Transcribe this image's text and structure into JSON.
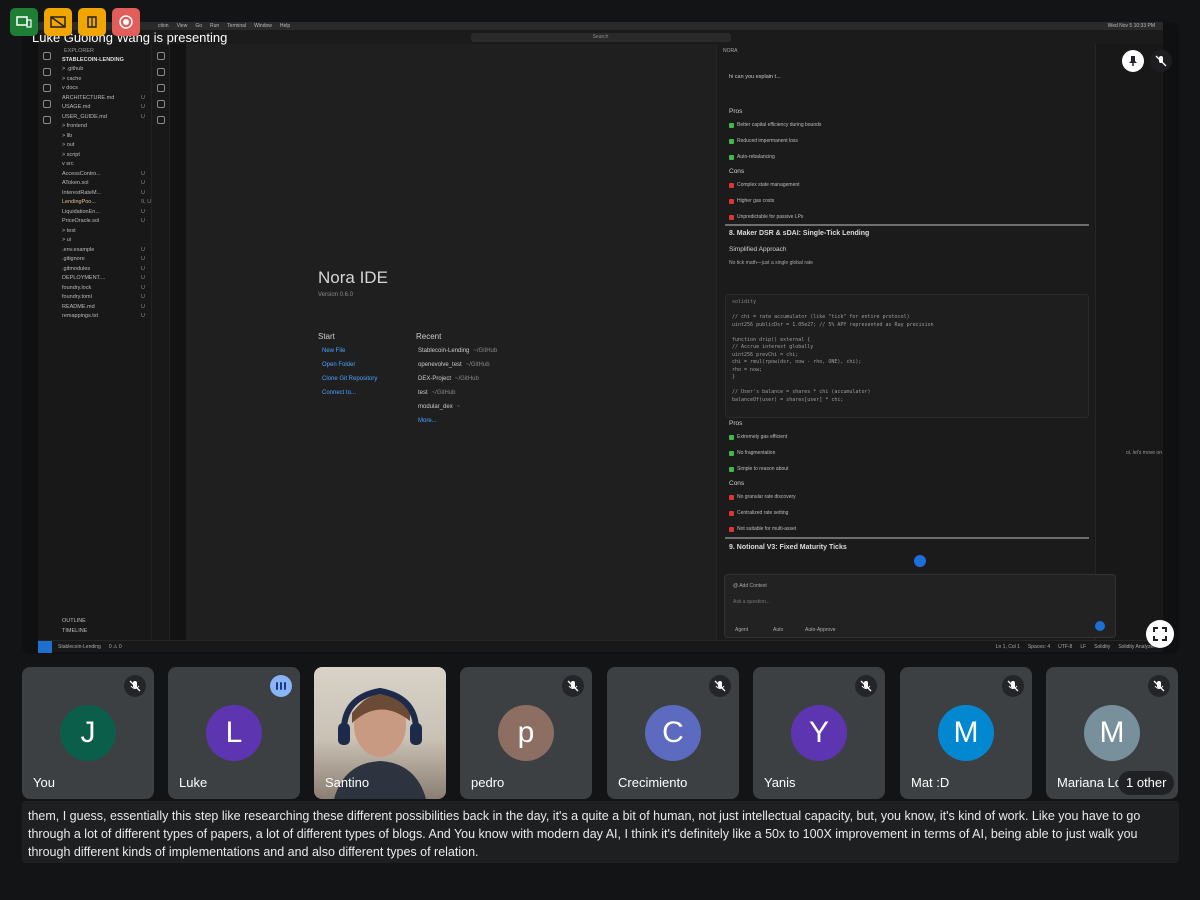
{
  "meet": {
    "presenting_text": "Luke Guolong Wang is presenting",
    "caption_text": "them, I guess, essentially this step like researching these different possibilities back in the day, it's a quite a bit of human, not just intellectual capacity, but, you know, it's kind of work. Like you have to go through a lot of different types of papers, a lot of different types of blogs. And You know with modern day AI, I think it's definitely like a 50x to 100X improvement in terms of AI, being able to just walk you through different kinds of implementations and and also different types of relation.",
    "other_count_label": "1 other",
    "colors": {
      "background": "#131416",
      "tile": "#3c4043",
      "speaking": "#8ab4f8"
    }
  },
  "participants": [
    {
      "name": "You",
      "initial": "J",
      "color": "#0b5e4a",
      "status": "muted"
    },
    {
      "name": "Luke",
      "initial": "L",
      "color": "#5e35b1",
      "status": "speaking"
    },
    {
      "name": "Santino",
      "initial": "",
      "color": "",
      "status": "video"
    },
    {
      "name": "pedro",
      "initial": "p",
      "color": "#8d6e63",
      "status": "muted"
    },
    {
      "name": "Crecimiento",
      "initial": "C",
      "color": "#5c6bc0",
      "status": "muted"
    },
    {
      "name": "Yanis",
      "initial": "Y",
      "color": "#5e35b1",
      "status": "muted"
    },
    {
      "name": "Mat :D",
      "initial": "M",
      "color": "#0288d1",
      "status": "muted"
    },
    {
      "name": "Mariana Lo",
      "initial": "M",
      "color": "#78909c",
      "status": "muted"
    }
  ],
  "ide": {
    "menu": [
      "ction",
      "View",
      "Go",
      "Run",
      "Terminal",
      "Window",
      "Help"
    ],
    "search_placeholder": "Search",
    "clock": "Wed Nov 5  10:33 PM",
    "explorer_header": "EXPLORER",
    "project_name": "STABLECOIN-LENDING",
    "tree": [
      {
        "name": "> .github",
        "status": ""
      },
      {
        "name": "> cache",
        "status": ""
      },
      {
        "name": "v docs",
        "status": ""
      },
      {
        "name": "   ARCHITECTURE.md",
        "status": "U"
      },
      {
        "name": "   USAGE.md",
        "status": "U"
      },
      {
        "name": "   USER_GUIDE.md",
        "status": "U"
      },
      {
        "name": "> frontend",
        "status": ""
      },
      {
        "name": "> lib",
        "status": ""
      },
      {
        "name": "> out",
        "status": ""
      },
      {
        "name": "> script",
        "status": ""
      },
      {
        "name": "v src",
        "status": ""
      },
      {
        "name": "   AccessContro...",
        "status": "U"
      },
      {
        "name": "   AToken.sol",
        "status": "U"
      },
      {
        "name": "   InterestRateM...",
        "status": "U"
      },
      {
        "name": "   LendingPoo...",
        "status": "9, U"
      },
      {
        "name": "   LiquidationEn...",
        "status": "U"
      },
      {
        "name": "   PriceOracle.sol",
        "status": "U"
      },
      {
        "name": "> test",
        "status": ""
      },
      {
        "name": "> ui",
        "status": ""
      },
      {
        "name": "  .env.example",
        "status": "U"
      },
      {
        "name": "  .gitignore",
        "status": "U"
      },
      {
        "name": "  .gitmodules",
        "status": "U"
      },
      {
        "name": "  DEPLOYMENT....",
        "status": "U"
      },
      {
        "name": "  foundry.lock",
        "status": "U"
      },
      {
        "name": "  foundry.toml",
        "status": "U"
      },
      {
        "name": "  README.md",
        "status": "U"
      },
      {
        "name": "  remappings.txt",
        "status": "U"
      }
    ],
    "outline_label": "OUTLINE",
    "timeline_label": "TIMELINE",
    "welcome": {
      "title": "Nora IDE",
      "version": "Version 0.6.0",
      "start_heading": "Start",
      "start_links": [
        "New File",
        "Open Folder",
        "Clone Git Repository",
        "Connect to..."
      ],
      "recent_heading": "Recent",
      "recent": [
        {
          "name": "Stablecoin-Lending",
          "path": "~/GitHub"
        },
        {
          "name": "openevolve_test",
          "path": "~/GitHub"
        },
        {
          "name": "DEX-Project",
          "path": "~/GitHub"
        },
        {
          "name": "test",
          "path": "~/GitHub"
        },
        {
          "name": "modular_dex",
          "path": "~"
        }
      ],
      "more_label": "More..."
    },
    "chat": {
      "header": "NORA",
      "question": "hi can you explain t...",
      "pros_label": "Pros",
      "pros_top": [
        "Better capital efficiency during bounds",
        "Reduced impermanent loss",
        "Auto-rebalancing"
      ],
      "cons_label": "Cons",
      "cons_top": [
        "Complex state management",
        "Higher gas costs",
        "Unpredictable for passive LPs"
      ],
      "section8_title": "8. Maker DSR & sDAI: Single-Tick Lending",
      "simplified_label": "Simplified Approach",
      "simplified_sub": "No tick math—just a single global rate",
      "code_lang": "solidity",
      "code_lines": [
        "// chi = rate accumulator (like \"tick\" for entire protocol)",
        "uint256 publicDsr = 1.05e27; // 5% APY represented as Ray precision",
        "",
        "function drip() external {",
        "    // Accrue interest globally",
        "    uint256 prevChi = chi;",
        "    chi = rmul(rpow(dsr, now - rho, ONE), chi);",
        "    rho = now;",
        "}",
        "",
        "// User's balance = shares * chi (accumulator)",
        "balanceOf(user) = shares[user] * chi;"
      ],
      "pros_bottom": [
        "Extremely gas efficient",
        "No fragmentation",
        "Simple to reason about"
      ],
      "cons_bottom": [
        "No granular rate discovery",
        "Centralized rate setting",
        "Not suitable for multi-asset"
      ],
      "section9_title": "9. Notional V3: Fixed Maturity Ticks",
      "add_context": "Add Context",
      "ask_placeholder": "Ask a question...",
      "mode_agent": "Agent",
      "mode_auto": "Auto",
      "mode_approve": "Auto-Approve",
      "side_note": "ol, let's move on"
    },
    "status": {
      "branch": "Stablecoin-Lending",
      "problems": "0 ⚠ 0",
      "cursor": "Ln 1, Col 1",
      "spaces": "Spaces: 4",
      "encoding": "UTF-8",
      "eol": "LF",
      "language": "Solidity",
      "analyzer": "Solidity Analyzer"
    }
  }
}
